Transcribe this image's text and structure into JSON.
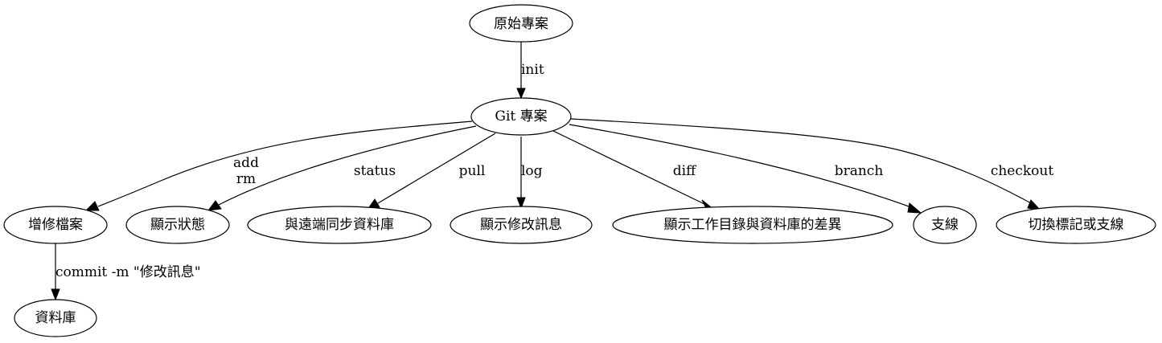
{
  "diagram": {
    "nodes": {
      "original_project": "原始專案",
      "git_project": "Git 專案",
      "add_modify_files": "增修檔案",
      "show_status": "顯示狀態",
      "sync_with_remote": "與遠端同步資料庫",
      "show_log_messages": "顯示修改訊息",
      "show_diff": "顯示工作目錄與資料庫的差異",
      "branch": "支線",
      "switch_tag_or_branch": "切換標記或支線",
      "repository": "資料庫"
    },
    "edges": {
      "init": "init",
      "add": "add",
      "rm": "rm",
      "status": "status",
      "pull": "pull",
      "log": "log",
      "diff": "diff",
      "branch": "branch",
      "checkout": "checkout",
      "commit": "commit -m \"修改訊息\""
    }
  }
}
